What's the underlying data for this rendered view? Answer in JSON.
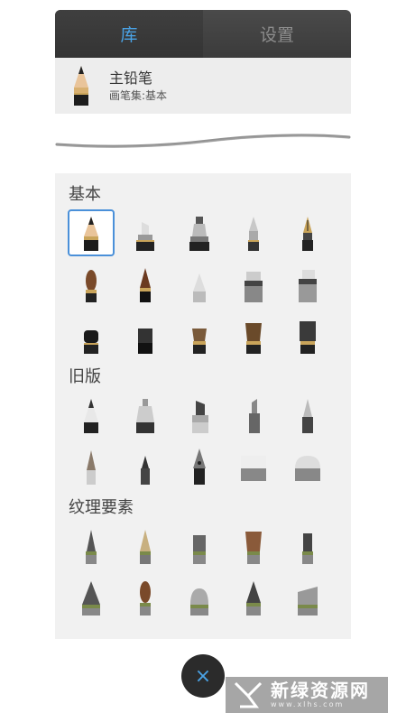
{
  "tabs": [
    {
      "label": "库",
      "active": true
    },
    {
      "label": "设置",
      "active": false
    }
  ],
  "current_brush": {
    "name": "主铅笔",
    "set": "画笔集:基本",
    "icon": "pencil-icon"
  },
  "sections": [
    {
      "title": "基本",
      "tools": [
        "pencil-icon",
        "marker-icon",
        "wide-marker-icon",
        "ballpoint-icon",
        "fountain-pen-icon",
        "round-brush-icon",
        "ink-brush-icon",
        "airbrush-icon",
        "smudge-icon",
        "eraser-stamp-icon",
        "flat-black-brush-icon",
        "flat-brush-icon",
        "fan-brush-icon",
        "wide-flat-brush-icon",
        "bristle-brush-icon"
      ]
    },
    {
      "title": "旧版",
      "tools": [
        "legacy-pencil-icon",
        "legacy-airbrush-icon",
        "legacy-marker-icon",
        "legacy-chisel-icon",
        "legacy-ballpoint-icon",
        "legacy-brush-icon",
        "legacy-felt-pen-icon",
        "legacy-nib-icon",
        "legacy-eraser-icon",
        "legacy-soft-eraser-icon"
      ]
    },
    {
      "title": "纹理要素",
      "tools": [
        "texture-spike-icon",
        "texture-pointed-icon",
        "texture-block-icon",
        "texture-bristles-icon",
        "texture-square-icon",
        "texture-cone-icon",
        "texture-brush-icon",
        "texture-round-icon",
        "texture-tree-icon",
        "texture-angled-icon"
      ]
    }
  ],
  "selected_tool": "pencil-icon",
  "close_label": "×",
  "watermark": {
    "cn": "新绿资源网",
    "en": "www.xlhs.com"
  },
  "colors": {
    "accent": "#4aa3e6",
    "selection": "#4a90d9"
  }
}
